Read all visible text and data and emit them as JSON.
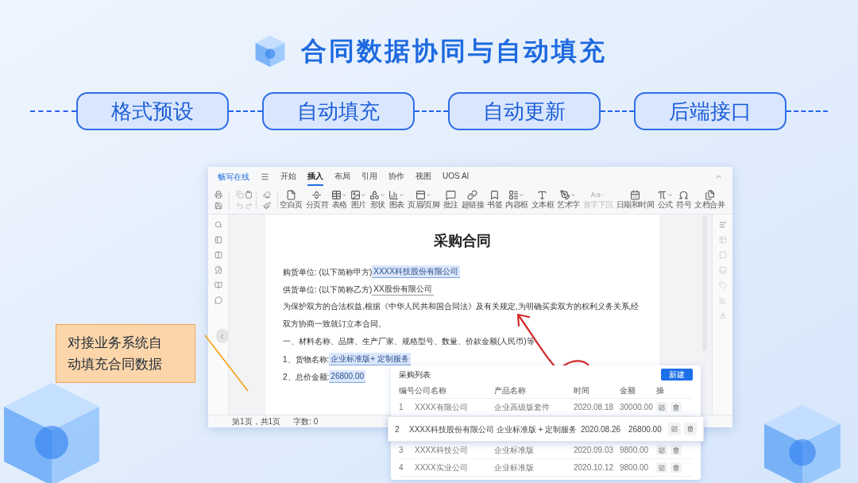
{
  "slide": {
    "title": "合同数据协同与自动填充",
    "steps": [
      "格式预设",
      "自动填充",
      "自动更新",
      "后端接口"
    ],
    "callout": "对接业务系统自动填充合同数据"
  },
  "editor": {
    "app_name": "畅写在线",
    "tabs": [
      {
        "label": "开始",
        "selected": false
      },
      {
        "label": "插入",
        "selected": true
      },
      {
        "label": "布局",
        "selected": false
      },
      {
        "label": "引用",
        "selected": false
      },
      {
        "label": "协作",
        "selected": false
      },
      {
        "label": "视图",
        "selected": false
      },
      {
        "label": "UOS AI",
        "selected": false
      }
    ],
    "toolbar": [
      {
        "label": "空白页",
        "dropdown": false,
        "disabled": false
      },
      {
        "label": "分页符",
        "dropdown": false,
        "disabled": false
      },
      {
        "label": "表格",
        "dropdown": true,
        "disabled": false
      },
      {
        "label": "图片",
        "dropdown": true,
        "disabled": false
      },
      {
        "label": "形状",
        "dropdown": true,
        "disabled": false
      },
      {
        "label": "图表",
        "dropdown": true,
        "disabled": false
      },
      {
        "label": "页眉/页脚",
        "dropdown": true,
        "disabled": false
      },
      {
        "label": "批注",
        "dropdown": false,
        "disabled": false
      },
      {
        "label": "超链接",
        "dropdown": false,
        "disabled": false
      },
      {
        "label": "书签",
        "dropdown": false,
        "disabled": false
      },
      {
        "label": "内容框",
        "dropdown": true,
        "disabled": false
      },
      {
        "label": "文本框",
        "dropdown": false,
        "disabled": false
      },
      {
        "label": "艺术字",
        "dropdown": true,
        "disabled": false
      },
      {
        "label": "首字下沉",
        "dropdown": true,
        "disabled": true
      },
      {
        "label": "日期和时间",
        "dropdown": false,
        "disabled": false
      },
      {
        "label": "公式",
        "dropdown": true,
        "disabled": false
      },
      {
        "label": "符号",
        "dropdown": false,
        "disabled": false
      },
      {
        "label": "文档合并",
        "dropdown": false,
        "disabled": false
      }
    ],
    "document": {
      "title": "采购合同",
      "paragraphs": [
        {
          "kind": "field",
          "label": "购货单位: (以下简称甲方) ",
          "value": "XXXX科技股份有限公司",
          "highlighted": true
        },
        {
          "kind": "field",
          "label": "供货单位: (以下简称乙方) ",
          "value": "XX股份有限公司",
          "highlighted": false
        },
        {
          "kind": "text",
          "text": "为保护双方的合法权益,根据《中华人民共和国合同法》及有关规定,为明确买卖双方的权利义务关系,经双方协商一致就订立本合同。"
        },
        {
          "kind": "text",
          "text": "一、材料名称、品牌、生产厂家、规格型号、数量、价款金额(人民币)等"
        },
        {
          "kind": "field",
          "label": "1、货物名称: ",
          "value": "企业标准版+ 定制服务",
          "highlighted": true
        },
        {
          "kind": "field",
          "label": "2、总价金额: ",
          "value": "26800.00",
          "highlighted": true
        }
      ]
    },
    "status_bar": [
      "第1页，共1页",
      "字数: 0"
    ]
  },
  "purchase_list": {
    "title": "采购列表",
    "new_button": "新建",
    "columns": [
      "编号",
      "公司名称",
      "产品名称",
      "时间",
      "金额",
      "操"
    ],
    "rows": [
      {
        "cells": [
          "1",
          "XXXX有限公司",
          "企业高级版套件",
          "2020.08.18",
          "30000.00"
        ],
        "selected": false
      },
      {
        "cells": [
          "2",
          "XXXX科技股份有限公司",
          "企业标准版 + 定制服务",
          "2020.08.26",
          "26800.00"
        ],
        "selected": true
      },
      {
        "cells": [
          "3",
          "XXXX科技公司",
          "企业标准版",
          "2020.09.03",
          "9800.00"
        ],
        "selected": false
      },
      {
        "cells": [
          "4",
          "XXXX实业公司",
          "企业标准版",
          "2020.10.12",
          "9800.00"
        ],
        "selected": false
      }
    ]
  }
}
